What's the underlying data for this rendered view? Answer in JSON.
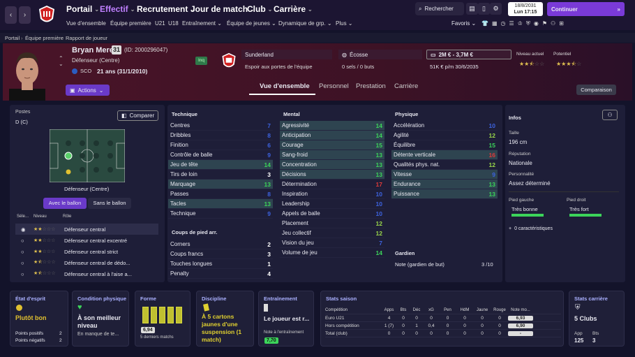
{
  "nav": {
    "main": [
      "Portail",
      "Effectif",
      "Recrutement",
      "Jour de match",
      "Club",
      "Carrière"
    ],
    "search": "Rechercher",
    "continue": "Continuer",
    "date": "18/8/2031",
    "time": "Lun 17:15",
    "favorites": "Favoris"
  },
  "subnav": [
    "Vue d'ensemble",
    "Équipe première",
    "U21",
    "U18",
    "Entraînement",
    "Équipe de jeunes",
    "Dynamique de grp.",
    "Plus"
  ],
  "breadcrumb": [
    "Portail",
    "Équipe première",
    "Rapport de joueur"
  ],
  "player": {
    "name": "Bryan Meres",
    "number": "31",
    "id": "(ID: 2000296047)",
    "position": "Défenseur (Centre)",
    "nation_code": "SCO",
    "age": "21 ans (31/1/2010)",
    "status": "Inq",
    "club": "Sunderland",
    "club_status": "Espoir aux portes de l'équipe",
    "country": "Écosse",
    "caps": "0 sels / 0 buts",
    "value": "2M € - 3,7M €",
    "wage": "51K € p/m 30/6/2035",
    "current_label": "Niveau actuel",
    "potential_label": "Potentiel",
    "actions": "Actions",
    "compare_btn": "Comparaison"
  },
  "tabs": [
    "Vue d'ensemble",
    "Personnel",
    "Prestation",
    "Carrière"
  ],
  "positions": {
    "title": "Postes",
    "pos": "D (C)",
    "compare": "Comparer",
    "role_label": "Défenseur (Centre)",
    "with_ball": "Avec le ballon",
    "without_ball": "Sans le ballon",
    "col_sel": "Séle...",
    "col_level": "Niveau",
    "col_role": "Rôle",
    "roles": [
      "Défenseur central",
      "Défenseur central excentré",
      "Défenseur central strict",
      "Défenseur central de dédo...",
      "Défenseur central à l'aise a..."
    ]
  },
  "technique": {
    "title": "Technique",
    "items": [
      [
        "Centres",
        "7"
      ],
      [
        "Dribbles",
        "8"
      ],
      [
        "Finition",
        "6"
      ],
      [
        "Contrôle de balle",
        "9"
      ],
      [
        "Jeu de tête",
        "14"
      ],
      [
        "Tirs de loin",
        "3"
      ],
      [
        "Marquage",
        "13"
      ],
      [
        "Passes",
        "8"
      ],
      [
        "Tacles",
        "13"
      ],
      [
        "Technique",
        "9"
      ]
    ]
  },
  "setpieces": {
    "title": "Coups de pied arr.",
    "items": [
      [
        "Corners",
        "2"
      ],
      [
        "Coups francs",
        "3"
      ],
      [
        "Touches longues",
        "1"
      ],
      [
        "Penalty",
        "4"
      ]
    ]
  },
  "mental": {
    "title": "Mental",
    "items": [
      [
        "Agressivité",
        "14"
      ],
      [
        "Anticipation",
        "14"
      ],
      [
        "Courage",
        "15"
      ],
      [
        "Sang-froid",
        "13"
      ],
      [
        "Concentration",
        "13"
      ],
      [
        "Décisions",
        "13"
      ],
      [
        "Détermination",
        "17"
      ],
      [
        "Inspiration",
        "10"
      ],
      [
        "Leadership",
        "10"
      ],
      [
        "Appels de balle",
        "10"
      ],
      [
        "Placement",
        "12"
      ],
      [
        "Jeu collectif",
        "12"
      ],
      [
        "Vision du jeu",
        "7"
      ],
      [
        "Volume de jeu",
        "14"
      ]
    ]
  },
  "physique": {
    "title": "Physique",
    "items": [
      [
        "Accélération",
        "10"
      ],
      [
        "Agilité",
        "12"
      ],
      [
        "Équilibre",
        "15"
      ],
      [
        "Détente verticale",
        "16"
      ],
      [
        "Qualités phys. nat.",
        "12"
      ],
      [
        "Vitesse",
        "9"
      ],
      [
        "Endurance",
        "13"
      ],
      [
        "Puissance",
        "13"
      ]
    ]
  },
  "goalkeeping": {
    "title": "Gardien",
    "label": "Note (gardien de but)",
    "value": "3 /10"
  },
  "info": {
    "title": "Infos",
    "height_label": "Taille",
    "height": "196 cm",
    "rep_label": "Réputation",
    "rep": "Nationale",
    "pers_label": "Personnalité",
    "pers": "Assez déterminé",
    "lfoot_label": "Pied gauche",
    "lfoot": "Très bonne",
    "rfoot_label": "Pied droit",
    "rfoot": "Très fort",
    "traits": "0 caractéristiques"
  },
  "cards": {
    "morale": {
      "title": "État d'esprit",
      "value": "Plutôt bon",
      "pos_label": "Points positifs",
      "pos": "2",
      "neg_label": "Points négatifs",
      "neg": "2"
    },
    "condition": {
      "title": "Condition physique",
      "value": "À son meilleur niveau",
      "sub": "En manque de te..."
    },
    "form": {
      "title": "Forme",
      "value": "6,94",
      "sub": "5 derniers matchs"
    },
    "discipline": {
      "title": "Discipline",
      "value": "À 5 cartons jaunes d'une suspension (1 match)"
    },
    "training": {
      "title": "Entraînement",
      "value": "Le joueur est r...",
      "note_label": "Note à l'entraînement",
      "note": "7,70"
    },
    "season": {
      "title": "Stats saison",
      "headers": [
        "Compétition",
        "Apps",
        "Bts",
        "Déc",
        "xG",
        "Pen",
        "HdM",
        "Jaune",
        "Rouge",
        "Note mo..."
      ],
      "rows": [
        [
          "Euro U21",
          "4",
          "0",
          "0",
          "0",
          "0",
          "0",
          "0",
          "0",
          "6,93"
        ],
        [
          "Hors compétition",
          "1 (7)",
          "0",
          "1",
          "0,4",
          "0",
          "0",
          "0",
          "0",
          "6,90"
        ],
        [
          "Total (club)",
          "0",
          "0",
          "0",
          "0",
          "0",
          "0",
          "0",
          "0",
          "-"
        ]
      ]
    },
    "career": {
      "title": "Stats carrière",
      "value": "5 Clubs",
      "app_label": "App",
      "app": "125",
      "bts_label": "Bts",
      "bts": "3"
    }
  }
}
